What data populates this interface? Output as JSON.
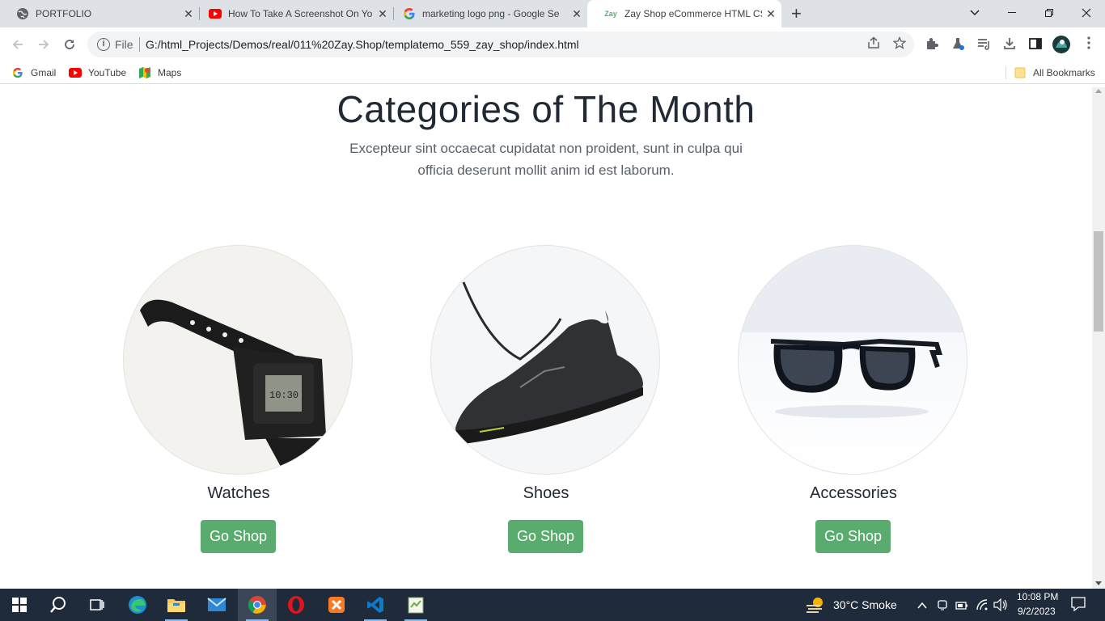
{
  "browser": {
    "tabs": [
      {
        "label": "PORTFOLIO",
        "icon": "globe-icon"
      },
      {
        "label": "How To Take A Screenshot On Yo",
        "icon": "youtube-icon"
      },
      {
        "label": "marketing logo png - Google Se",
        "icon": "google-icon"
      },
      {
        "label": "Zay Shop eCommerce HTML CSS",
        "icon": "zay-favicon",
        "favicon_text": "Zay"
      }
    ],
    "address": {
      "scheme_label": "File",
      "url": "G:/html_Projects/Demos/real/011%20Zay.Shop/templatemo_559_zay_shop/index.html"
    },
    "bookmarks": [
      {
        "label": "Gmail",
        "icon": "google-icon"
      },
      {
        "label": "YouTube",
        "icon": "youtube-icon"
      },
      {
        "label": "Maps",
        "icon": "maps-icon"
      }
    ],
    "all_bookmarks_label": "All Bookmarks"
  },
  "section": {
    "title": "Categories of The Month",
    "subtitle": "Excepteur sint occaecat cupidatat non proident, sunt in culpa qui officia deserunt mollit anim id est laborum."
  },
  "categories": [
    {
      "name": "Watches",
      "button": "Go Shop",
      "image": "watch-image"
    },
    {
      "name": "Shoes",
      "button": "Go Shop",
      "image": "shoe-image"
    },
    {
      "name": "Accessories",
      "button": "Go Shop",
      "image": "sunglasses-image"
    }
  ],
  "colors": {
    "accent": "#59ab6e",
    "heading": "#212934"
  },
  "taskbar": {
    "weather": "30°C  Smoke",
    "time": "10:08 PM",
    "date": "9/2/2023"
  }
}
